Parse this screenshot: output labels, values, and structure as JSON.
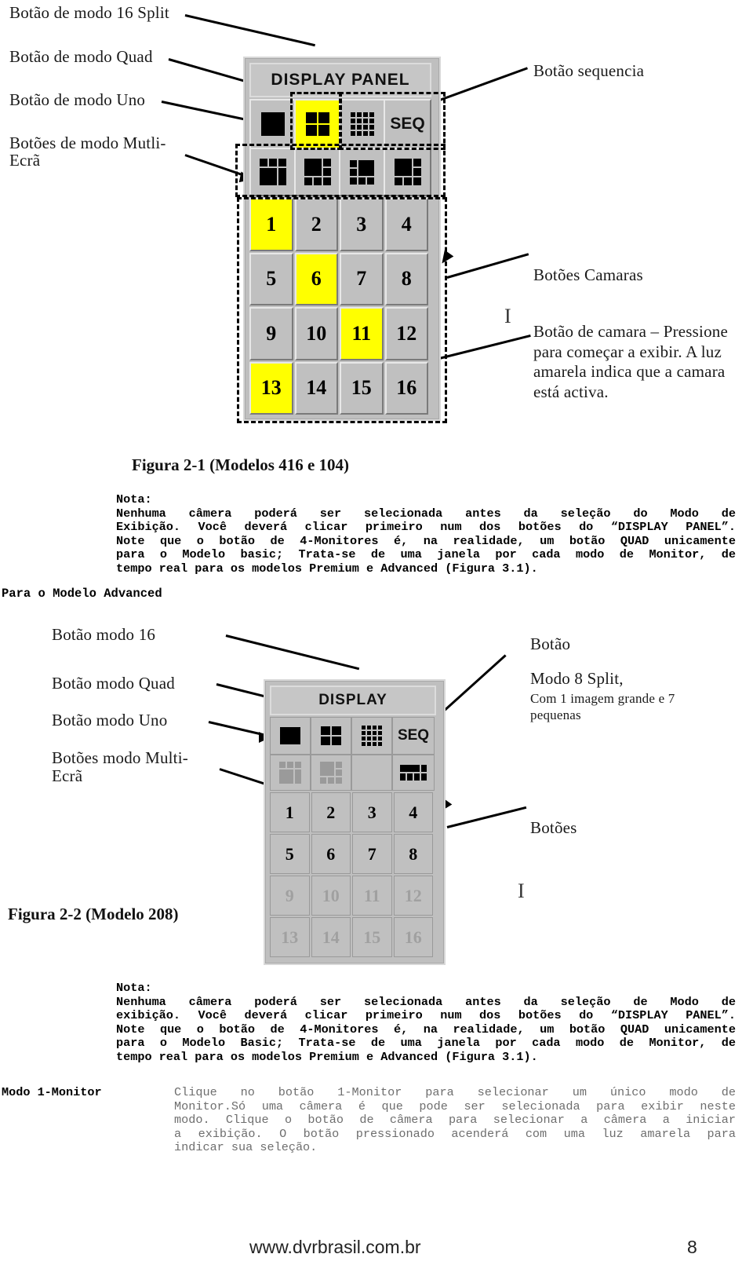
{
  "figure1": {
    "caption": "Figura 2-1 (Modelos 416 e 104)",
    "panel_title": "DISPLAY PANEL",
    "seq_label": "SEQ",
    "labels_left": [
      "Botão de modo 16 Split",
      "Botão de modo Quad",
      "Botão de modo Uno",
      "Botões de modo Mutli-",
      "Ecrã"
    ],
    "labels_right": {
      "sequence": "Botão sequencia",
      "cameras": "Botões Camaras",
      "camera_detail": "Botão de camara – Pressione para começar a exibir. A luz amarela indica que a camara está activa."
    },
    "camera_buttons": [
      "1",
      "2",
      "3",
      "4",
      "5",
      "6",
      "7",
      "8",
      "9",
      "10",
      "11",
      "12",
      "13",
      "14",
      "15",
      "16"
    ],
    "camera_active": [
      1,
      6,
      11,
      13
    ],
    "highlight_color": "#ffff00",
    "panel_color": "#bfbfbf"
  },
  "note1": {
    "title": "Nota:",
    "lines": [
      "Nenhuma câmera poderá ser selecionada antes da seleção do Modo de",
      "Exibição. Você deverá clicar primeiro num dos botões do “DISPLAY PANEL”.",
      "Note que o botão de 4-Monitores é, na realidade, um botão QUAD unicamente",
      "para o Modelo basic; Trata-se de uma janela por cada modo de Monitor, de",
      "tempo real para os modelos Premium e Advanced (Figura 3.1)."
    ]
  },
  "section_heading": "Para o Modelo Advanced",
  "figure2": {
    "caption": "Figura 2-2 (Modelo 208)",
    "panel_title": "DISPLAY",
    "seq_label": "SEQ",
    "labels_left": [
      "Botão modo 16",
      "Botão modo Quad",
      "Botão modo Uno",
      "Botões modo Multi-",
      "Ecrã"
    ],
    "labels_right": {
      "button": "Botão",
      "mode8": "Modo 8 Split,",
      "mode8_sub": "Com 1 imagem grande e 7 pequenas",
      "buttons": "Botões"
    },
    "camera_buttons": [
      "1",
      "2",
      "3",
      "4",
      "5",
      "6",
      "7",
      "8",
      "9",
      "10",
      "11",
      "12",
      "13",
      "14",
      "15",
      "16"
    ],
    "camera_enabled": [
      1,
      2,
      3,
      4,
      5,
      6,
      7,
      8
    ]
  },
  "note2": {
    "title": "Nota:",
    "lines": [
      "Nenhuma câmera poderá ser selecionada antes da seleção de Modo de",
      "exibição. Você deverá clicar primeiro num dos botões do “DISPLAY PANEL”.",
      "Note que o botão de 4-Monitores é, na realidade, um botão QUAD unicamente",
      "para o Modelo Basic; Trata-se de uma janela por cada modo de Monitor, de",
      "tempo real para os modelos Premium e Advanced (Figura 3.1)."
    ]
  },
  "mode_entry": {
    "term": "Modo 1-Monitor",
    "lines": [
      "Clique no botão 1-Monitor para selecionar um único modo de",
      "Monitor.Só uma câmera é que pode ser selecionada para exibir neste",
      "modo. Clique o botão de câmera para selecionar a câmera a iniciar",
      "a exibição. O botão pressionado acenderá com uma luz amarela para",
      "indicar sua seleção."
    ]
  },
  "footer": {
    "site": "www.dvrbrasil.com.br",
    "page": "8"
  }
}
